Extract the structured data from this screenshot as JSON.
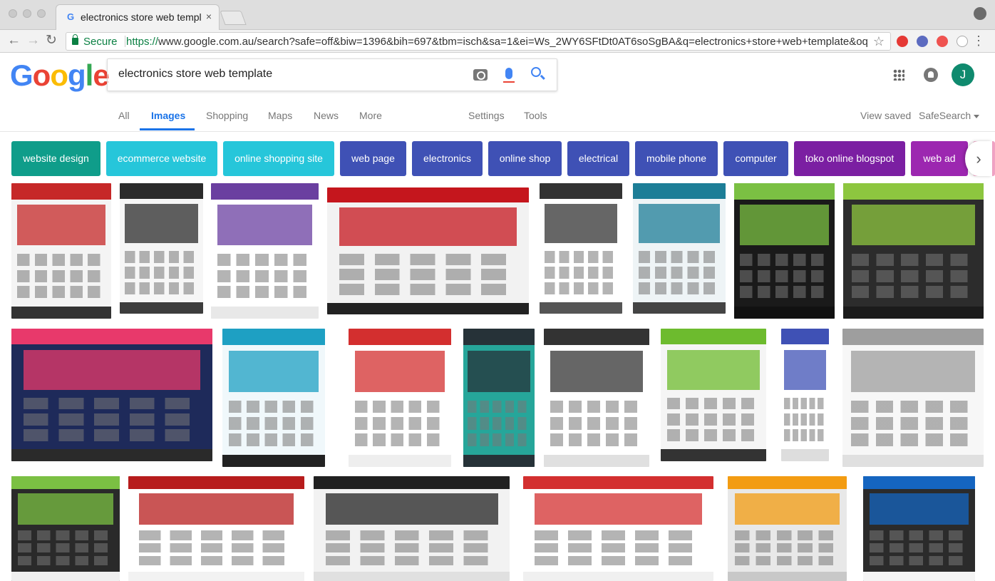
{
  "browser": {
    "tab_title": "electronics store web template",
    "tab_close": "×",
    "secure_label": "Secure",
    "url_scheme": "https://",
    "url_rest": "www.google.com.au/search?safe=off&biw=1396&bih=697&tbm=isch&sa=1&ei=Ws_2WY6SFtDt0AT6soSgBA&q=electronics+store+web+template&oq...",
    "back_icon": "←",
    "forward_icon": "→",
    "reload_icon": "↻",
    "star_icon": "☆",
    "menu_icon": "⋮",
    "colors": {
      "secure": "#0b8043"
    }
  },
  "google": {
    "logo_letters": [
      {
        "char": "G",
        "color": "#4285f4"
      },
      {
        "char": "o",
        "color": "#ea4335"
      },
      {
        "char": "o",
        "color": "#fbbc05"
      },
      {
        "char": "g",
        "color": "#4285f4"
      },
      {
        "char": "l",
        "color": "#34a853"
      },
      {
        "char": "e",
        "color": "#ea4335"
      }
    ],
    "search_value": "electronics store web template",
    "avatar_letter": "J",
    "avatar_color": "#0f8a6e"
  },
  "nav": {
    "tabs": [
      "All",
      "Images",
      "Shopping",
      "Maps",
      "News",
      "More"
    ],
    "active": "Images",
    "settings": "Settings",
    "tools": "Tools",
    "view_saved": "View saved",
    "safesearch": "SafeSearch"
  },
  "chips": [
    {
      "label": "website design",
      "color": "#0f9d8a"
    },
    {
      "label": "ecommerce website",
      "color": "#26c6da"
    },
    {
      "label": "online shopping site",
      "color": "#26c6da"
    },
    {
      "label": "web page",
      "color": "#3f51b5"
    },
    {
      "label": "electronics",
      "color": "#3f51b5"
    },
    {
      "label": "online shop",
      "color": "#3f51b5"
    },
    {
      "label": "electrical",
      "color": "#3f51b5"
    },
    {
      "label": "mobile phone",
      "color": "#3f51b5"
    },
    {
      "label": "computer",
      "color": "#3f51b5"
    },
    {
      "label": "toko online blogspot",
      "color": "#7b1fa2"
    },
    {
      "label": "web ad",
      "color": "#9c27b0"
    }
  ],
  "chip_next_icon": "›",
  "results": [
    {
      "bg": "#f4f4f4",
      "accent": "#c62828",
      "foot": "#333"
    },
    {
      "bg": "#f6f6f6",
      "accent": "#2b2b2b",
      "foot": "#3d3d3d"
    },
    {
      "bg": "#ffffff",
      "accent": "#6a3fa0",
      "foot": "#e8e8e8"
    },
    {
      "bg": "#f2f2f2",
      "accent": "#c5161d",
      "foot": "#222"
    },
    {
      "bg": "#ffffff",
      "accent": "#333333",
      "foot": "#555"
    },
    {
      "bg": "#eef4f6",
      "accent": "#1d7e97",
      "foot": "#444"
    },
    {
      "bg": "#1a1a1a",
      "accent": "#7bc043",
      "foot": "#111"
    },
    {
      "bg": "#2c2c2c",
      "accent": "#8dc63f",
      "foot": "#1b1b1b"
    },
    {
      "bg": "#1e2a5a",
      "accent": "#e8396b",
      "foot": "#2a2a2a"
    },
    {
      "bg": "#f0f8fb",
      "accent": "#1ea0c3",
      "foot": "#222"
    },
    {
      "bg": "#ffffff",
      "accent": "#d32f2f",
      "foot": "#eee"
    },
    {
      "bg": "#26a69a",
      "accent": "#263238",
      "foot": "#263238"
    },
    {
      "bg": "#ffffff",
      "accent": "#333333",
      "foot": "#e0e0e0"
    },
    {
      "bg": "#f5f5f5",
      "accent": "#6dbb2e",
      "foot": "#333"
    },
    {
      "bg": "#ffffff",
      "accent": "#3f51b5",
      "foot": "#ddd"
    },
    {
      "bg": "#f7f7f7",
      "accent": "#9e9e9e",
      "foot": "#e0e0e0"
    },
    {
      "bg": "#2a2a2a",
      "accent": "#7bc043",
      "foot": "#f0f0f0"
    },
    {
      "bg": "#ffffff",
      "accent": "#b71c1c",
      "foot": "#f2f2f2"
    },
    {
      "bg": "#f2f2f2",
      "accent": "#212121",
      "foot": "#e0e0e0"
    },
    {
      "bg": "#ffffff",
      "accent": "#d32f2f",
      "foot": "#f0f0f0"
    },
    {
      "bg": "#e8e8e8",
      "accent": "#f39c12",
      "foot": "#c8c8c8"
    },
    {
      "bg": "#2b2b2b",
      "accent": "#1565c0",
      "foot": "#f4f4f4"
    }
  ]
}
